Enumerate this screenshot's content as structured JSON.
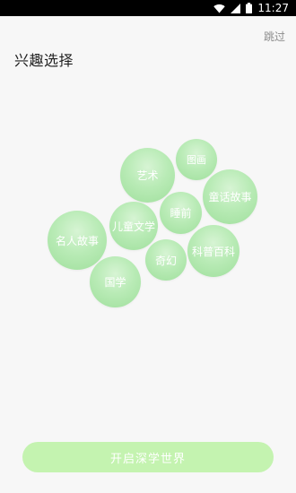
{
  "status_bar": {
    "time": "11:27"
  },
  "header": {
    "skip_label": "跳过",
    "title": "兴趣选择"
  },
  "interests": [
    {
      "label": "艺术"
    },
    {
      "label": "图画"
    },
    {
      "label": "童话故事"
    },
    {
      "label": "睡前"
    },
    {
      "label": "儿童文学"
    },
    {
      "label": "名人故事"
    },
    {
      "label": "科普百科"
    },
    {
      "label": "奇幻"
    },
    {
      "label": "国学"
    }
  ],
  "start_button": {
    "label": "开启深学世界"
  }
}
